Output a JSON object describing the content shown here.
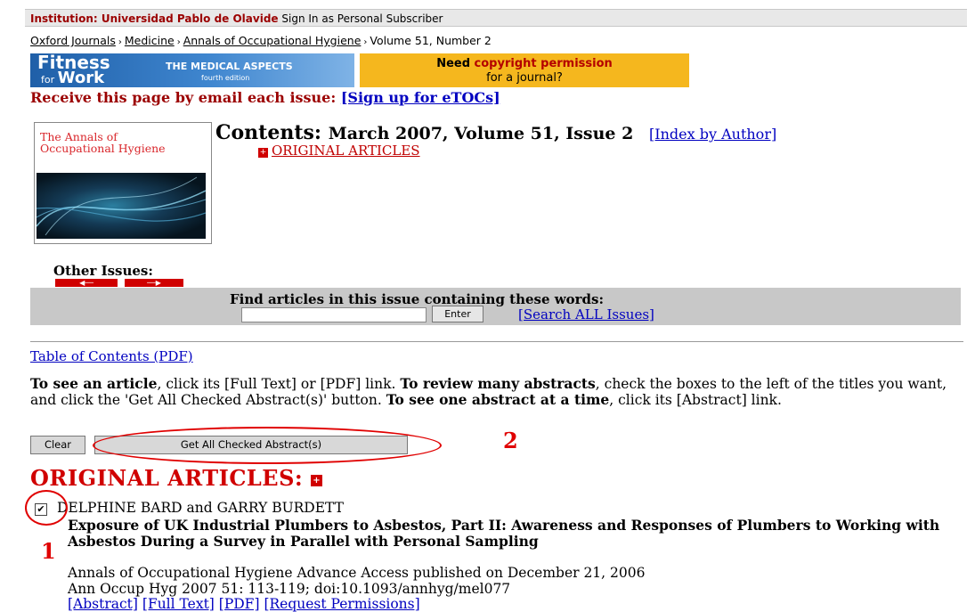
{
  "topbar": {
    "institution": "Institution: Universidad Pablo de Olavide",
    "signin": "Sign In as Personal Subscriber"
  },
  "breadcrumb": {
    "items": [
      "Oxford Journals",
      "Medicine",
      "Annals of Occupational Hygiene"
    ],
    "current": "Volume 51, Number 2",
    "separator": "›"
  },
  "ads": {
    "fitness_line1": "Fitness",
    "fitness_for": "for",
    "fitness_work": "Work",
    "fitness_tag": "THE MEDICAL ASPECTS",
    "fitness_edition": "fourth edition",
    "copyright_pre": "Need ",
    "copyright_hl": "copyright permission",
    "copyright_line2": "for a journal?"
  },
  "email": {
    "text": "Receive this page by email each issue: ",
    "link": "[Sign up for eTOCs]"
  },
  "cover": {
    "title_line1": "The Annals of",
    "title_line2": "Occupational Hygiene"
  },
  "contents": {
    "label": "Contents:",
    "issue": "March 2007, Volume 51, Issue 2",
    "index_link": "[Index by Author]",
    "section_link": "ORIGINAL ARTICLES"
  },
  "other_issues": {
    "label": "Other Issues:"
  },
  "search": {
    "label": "Find articles in this issue containing these words:",
    "input_value": "",
    "button": "Enter",
    "all_link": "[Search ALL Issues]"
  },
  "toc_pdf": "Table of Contents (PDF)",
  "instructions": {
    "p1_bold": "To see an article",
    "p1": ", click its [Full Text] or [PDF] link. ",
    "p2_bold": "To review many abstracts",
    "p2": ", check the boxes to the left of the titles you want, and click the 'Get All Checked Abstract(s)' button. ",
    "p3_bold": "To see one abstract at a time",
    "p3": ", click its [Abstract] link."
  },
  "buttons": {
    "clear": "Clear",
    "get_all": "Get All Checked Abstract(s)"
  },
  "section_title": "ORIGINAL ARTICLES:",
  "article": {
    "checked": true,
    "authors": "DELPHINE BARD and GARRY BURDETT",
    "title": "Exposure of UK Industrial Plumbers to Asbestos, Part II: Awareness and Responses of Plumbers to Working with Asbestos During a Survey in Parallel with Personal Sampling",
    "cite1": "Annals of Occupational Hygiene Advance Access published on December 21, 2006",
    "cite2": "Ann Occup Hyg 2007 51: 113-119; doi:10.1093/annhyg/mel077",
    "links": [
      "[Abstract]",
      "[Full Text]",
      "[PDF]",
      "[Request Permissions]"
    ]
  },
  "annotations": {
    "label1": "1",
    "label2": "2",
    "color": "#e00000"
  }
}
